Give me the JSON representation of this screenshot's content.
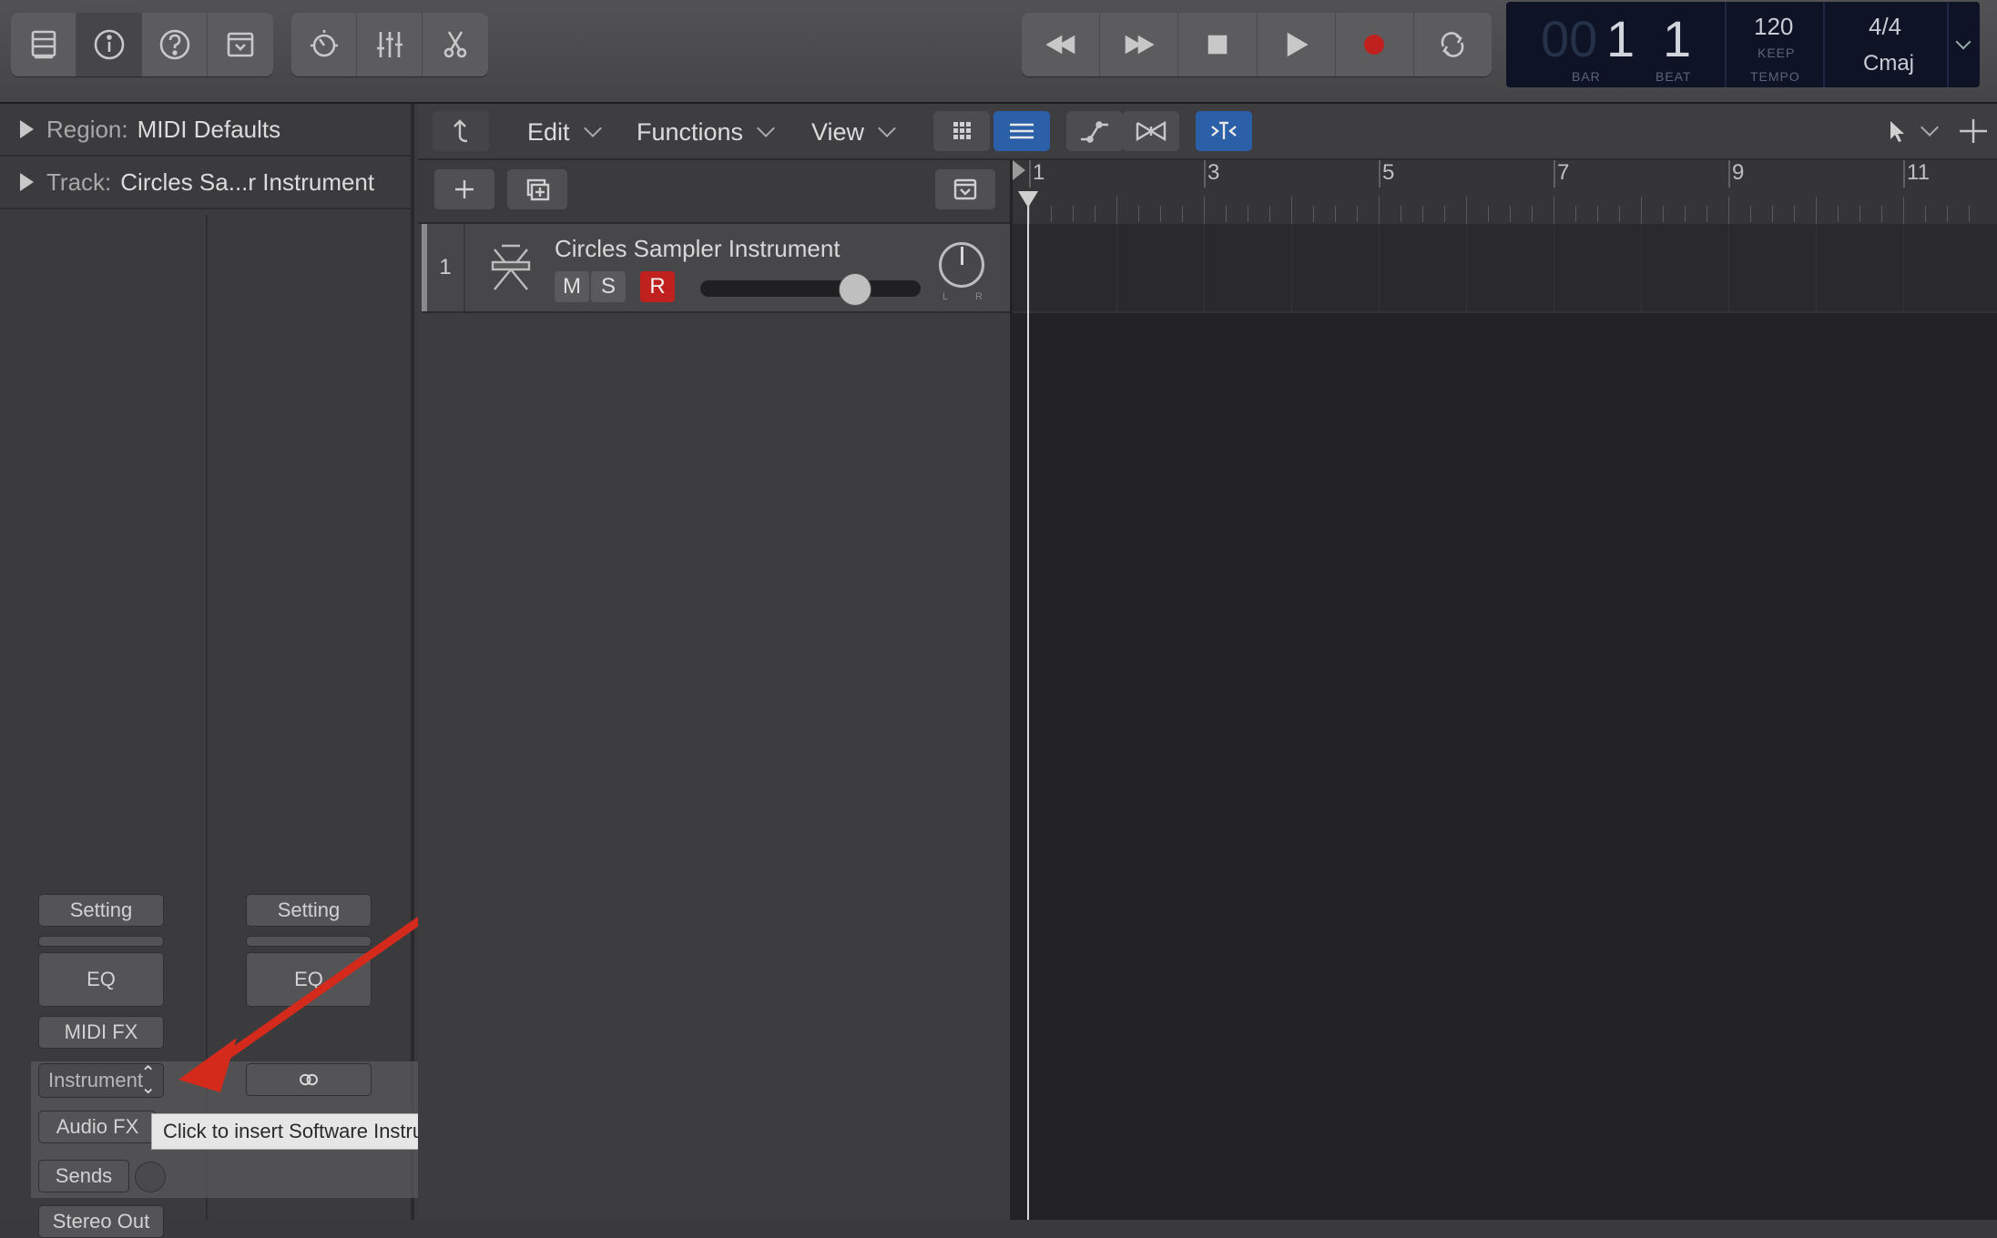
{
  "toolbar": {
    "left_icons": [
      "library-icon",
      "inspector-icon",
      "quick-help-icon",
      "toolbar-icon"
    ],
    "edit_icons": [
      "smart-controls-icon",
      "mixer-icon",
      "editors-icon"
    ],
    "transport_icons": [
      "rewind-icon",
      "fast-forward-icon",
      "stop-icon",
      "play-icon",
      "record-icon",
      "cycle-icon"
    ],
    "lcd": {
      "bar_dim": "00",
      "bar": "1",
      "beat": "1",
      "bar_label": "BAR",
      "beat_label": "BEAT",
      "tempo": "120",
      "tempo_mode": "KEEP",
      "tempo_label": "TEMPO",
      "time_signature": "4/4",
      "key": "Cmaj"
    }
  },
  "inspector": {
    "region_label": "Region:",
    "region_value": "MIDI Defaults",
    "track_label": "Track:",
    "track_value": "Circles Sa...r Instrument",
    "strip_left": {
      "setting": "Setting",
      "eq": "EQ",
      "midi_fx": "MIDI FX",
      "instrument": "Instrument",
      "audio_fx": "Audio FX",
      "sends": "Sends",
      "stereo_out": "Stereo Out"
    },
    "strip_right": {
      "setting": "Setting",
      "eq": "EQ"
    },
    "tooltip": "Click to insert Software Instrument plug-in"
  },
  "tracks_header": {
    "edit": "Edit",
    "functions": "Functions",
    "view": "View"
  },
  "tracks": [
    {
      "number": "1",
      "name": "Circles Sampler Instrument",
      "mute": "M",
      "solo": "S",
      "record": "R",
      "pan_left": "L",
      "pan_right": "R",
      "volume": 0.7
    }
  ],
  "ruler": {
    "bars": [
      "1",
      "3",
      "5",
      "7",
      "9",
      "11"
    ]
  },
  "colors": {
    "record_red": "#c0201e",
    "lcd_bg": "#0e1426",
    "active_blue": "#2b5fa8"
  }
}
